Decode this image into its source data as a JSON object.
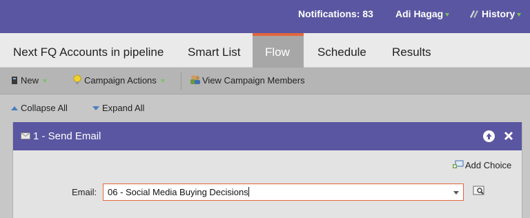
{
  "topbar": {
    "notifications": "Notifications: 83",
    "user": "Adi Hagag",
    "history": "History"
  },
  "tabs": [
    {
      "label": "Next FQ Accounts in pipeline",
      "active": false
    },
    {
      "label": "Smart List",
      "active": false
    },
    {
      "label": "Flow",
      "active": true
    },
    {
      "label": "Schedule",
      "active": false
    },
    {
      "label": "Results",
      "active": false
    }
  ],
  "toolbar": {
    "new_label": "New",
    "campaign_actions_label": "Campaign Actions",
    "view_members_label": "View Campaign Members"
  },
  "tree_controls": {
    "collapse_all": "Collapse All",
    "expand_all": "Expand All"
  },
  "flow_step": {
    "title": "1 - Send Email",
    "add_choice": "Add Choice",
    "email_label": "Email:",
    "email_value": "06 - Social Media Buying Decisions"
  },
  "colors": {
    "header_purple": "#5a56a1",
    "active_tab_accent": "#e3663a",
    "selected_field_border": "#e3663a"
  }
}
